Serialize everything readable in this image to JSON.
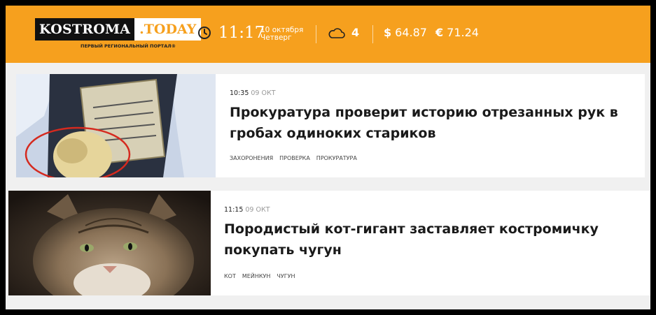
{
  "header": {
    "logo_main": "KOSTROMA",
    "logo_today": ".TODAY",
    "tagline": "ПЕРВЫЙ РЕГИОНАЛЬНЫЙ ПОРТАЛ®",
    "time": "11:17",
    "date_line1": "10 октября",
    "date_line2": "Четверг",
    "temperature": "4",
    "usd_symbol": "$",
    "usd_rate": "64.87",
    "eur_symbol": "€",
    "eur_rate": "71.24",
    "colors": {
      "accent": "#f6a01e"
    }
  },
  "news": [
    {
      "time": "10:35",
      "date": "09 ОКТ",
      "title": "Прокуратура проверит историю отрезанных рук в гробах одиноких стариков",
      "tags": [
        "ЗАХОРОНЕНИЯ",
        "ПРОВЕРКА",
        "ПРОКУРАТУРА"
      ]
    },
    {
      "time": "11:15",
      "date": "09 ОКТ",
      "title": "Породистый кот-гигант заставляет костромичку покупать чугун",
      "tags": [
        "КОТ",
        "МЕЙНКУН",
        "ЧУГУН"
      ]
    }
  ]
}
